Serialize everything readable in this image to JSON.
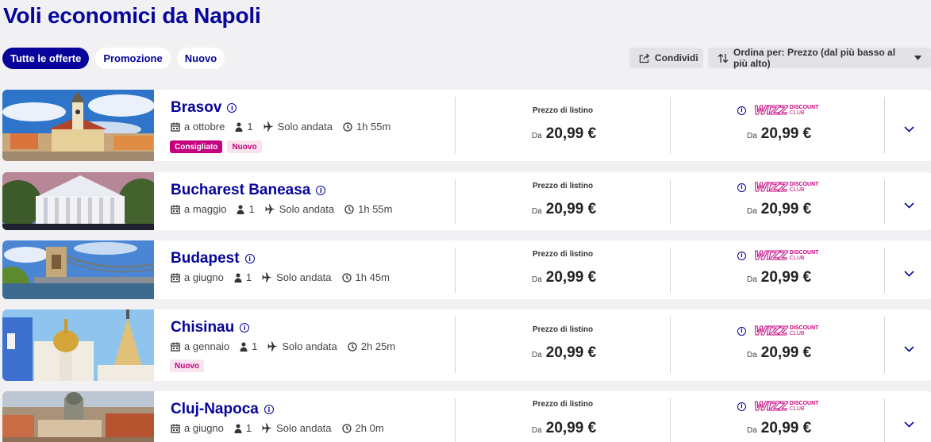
{
  "header": {
    "title_prefix": "Voli economici ",
    "title_bold": "da Napoli"
  },
  "filters": [
    "Tutte le offerte",
    "Promozione",
    "Nuovo"
  ],
  "toolbar": {
    "share_label": "Condividi",
    "sort_label": "Ordina per: Prezzo (dal più basso al più alto)"
  },
  "labels": {
    "list_price": "Prezzo di listino",
    "from": "Da",
    "club_line1": "DISCOUNT",
    "club_line2": "CLUB"
  },
  "icons": [
    "info-icon",
    "calendar-icon",
    "person-icon",
    "plane-icon",
    "clock-icon",
    "share-icon",
    "sort-icon",
    "chevron-down-icon"
  ],
  "colors": {
    "brand": "#06049a",
    "accent": "#c6007e",
    "background": "#f1f1f3"
  },
  "cards": [
    {
      "city": "Brasov",
      "month": "a ottobre",
      "passengers": "1",
      "trip": "Solo andata",
      "duration": "1h 55m",
      "badges": [
        "Consigliato",
        "Nuovo"
      ],
      "price": "20,99 €",
      "club_price": "20,99 €"
    },
    {
      "city": "Bucharest Baneasa",
      "month": "a maggio",
      "passengers": "1",
      "trip": "Solo andata",
      "duration": "1h 55m",
      "badges": [],
      "price": "20,99 €",
      "club_price": "20,99 €"
    },
    {
      "city": "Budapest",
      "month": "a giugno",
      "passengers": "1",
      "trip": "Solo andata",
      "duration": "1h 45m",
      "badges": [],
      "price": "20,99 €",
      "club_price": "20,99 €"
    },
    {
      "city": "Chisinau",
      "month": "a gennaio",
      "passengers": "1",
      "trip": "Solo andata",
      "duration": "2h 25m",
      "badges": [
        "Nuovo"
      ],
      "price": "20,99 €",
      "club_price": "20,99 €"
    },
    {
      "city": "Cluj-Napoca",
      "month": "a giugno",
      "passengers": "1",
      "trip": "Solo andata",
      "duration": "2h 0m",
      "badges": [],
      "price": "20,99 €",
      "club_price": "20,99 €"
    }
  ]
}
